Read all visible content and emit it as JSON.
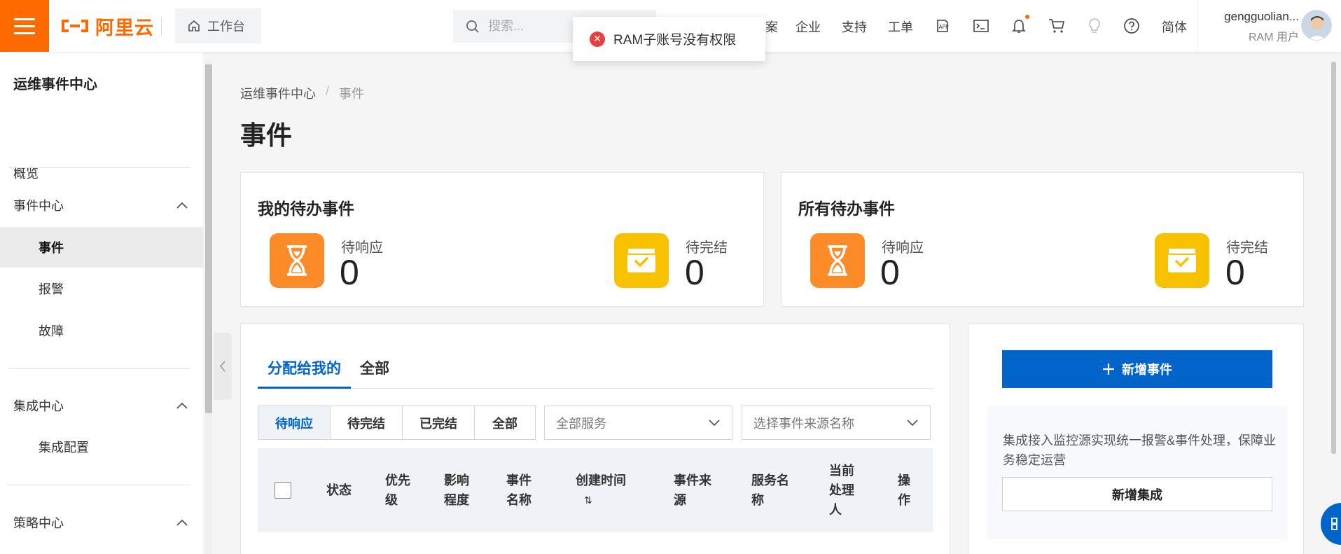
{
  "topbar": {
    "logo_text": "阿里云",
    "workbench_label": "工作台",
    "search_placeholder": "搜索...",
    "nav": [
      "案",
      "企业",
      "支持",
      "工单"
    ],
    "language": "简体",
    "user_name": "gengguolian...",
    "user_role": "RAM 用户",
    "icons": [
      "app-icon",
      "terminal-icon",
      "bell-icon",
      "cart-icon",
      "lightbulb-icon",
      "help-icon"
    ],
    "accent_color": "#ff6a00"
  },
  "toast": {
    "message": "RAM子账号没有权限",
    "status_color": "#e84040"
  },
  "sidebar": {
    "title": "运维事件中心",
    "overview": "概览",
    "groups": [
      {
        "label": "事件中心",
        "items": [
          "事件",
          "报警",
          "故障"
        ]
      },
      {
        "label": "集成中心",
        "items": [
          "集成配置"
        ]
      },
      {
        "label": "策略中心",
        "items": []
      }
    ],
    "active_item": "事件"
  },
  "main": {
    "breadcrumb": [
      "运维事件中心",
      "/",
      "事件"
    ],
    "title": "事件",
    "my_pending": {
      "title": "我的待办事件",
      "response_label": "待响应",
      "response_value": "0",
      "complete_label": "待完结",
      "complete_value": "0"
    },
    "all_pending": {
      "title": "所有待办事件",
      "response_label": "待响应",
      "response_value": "0",
      "complete_label": "待完结",
      "complete_value": "0"
    },
    "tabs": [
      "分配给我的",
      "全部"
    ],
    "status_filters": [
      "待响应",
      "待完结",
      "已完结",
      "全部"
    ],
    "service_select": "全部服务",
    "source_select": "选择事件来源名称",
    "columns": {
      "status": "状态",
      "priority": [
        "优先",
        "级"
      ],
      "impact": [
        "影响",
        "程度"
      ],
      "name": [
        "事件",
        "名称"
      ],
      "created": "创建时间",
      "sort_icon": "⇅",
      "source": [
        "事件来",
        "源"
      ],
      "service": [
        "服务名",
        "称"
      ],
      "handler": [
        "当前",
        "处理",
        "人"
      ],
      "action": [
        "操",
        "作"
      ]
    }
  },
  "aside": {
    "new_event": "新增事件",
    "info": "集成接入监控源实现统一报警&事件处理，保障业务稳定运营",
    "new_integration": "新增集成",
    "primary_color": "#0064c8"
  }
}
